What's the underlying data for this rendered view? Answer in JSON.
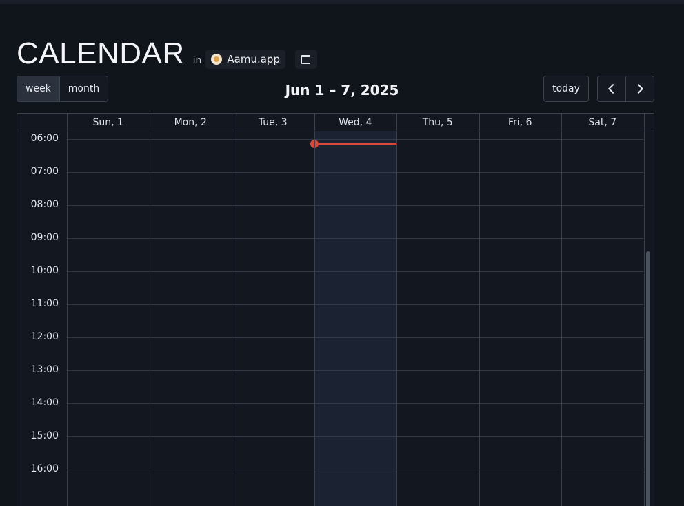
{
  "header": {
    "title": "CALENDAR",
    "in_label": "in",
    "workspace_name": "Aamu.app",
    "calendar_icon": "calendar-icon"
  },
  "toolbar": {
    "views": [
      {
        "label": "week",
        "active": true
      },
      {
        "label": "month",
        "active": false
      }
    ],
    "range_title": "Jun 1 – 7, 2025",
    "today_label": "today",
    "prev_icon": "chevron-left-icon",
    "next_icon": "chevron-right-icon"
  },
  "calendar": {
    "days": [
      "Sun, 1",
      "Mon, 2",
      "Tue, 3",
      "Wed, 4",
      "Thu, 5",
      "Fri, 6",
      "Sat, 7"
    ],
    "today_index": 3,
    "hours": [
      "06:00",
      "07:00",
      "08:00",
      "09:00",
      "10:00",
      "11:00",
      "12:00",
      "13:00",
      "14:00",
      "15:00",
      "16:00"
    ],
    "now_indicator_color": "#e0473a"
  },
  "colors": {
    "background": "#10141b",
    "today_column": "#1b2332",
    "grid": "#3a414d"
  }
}
